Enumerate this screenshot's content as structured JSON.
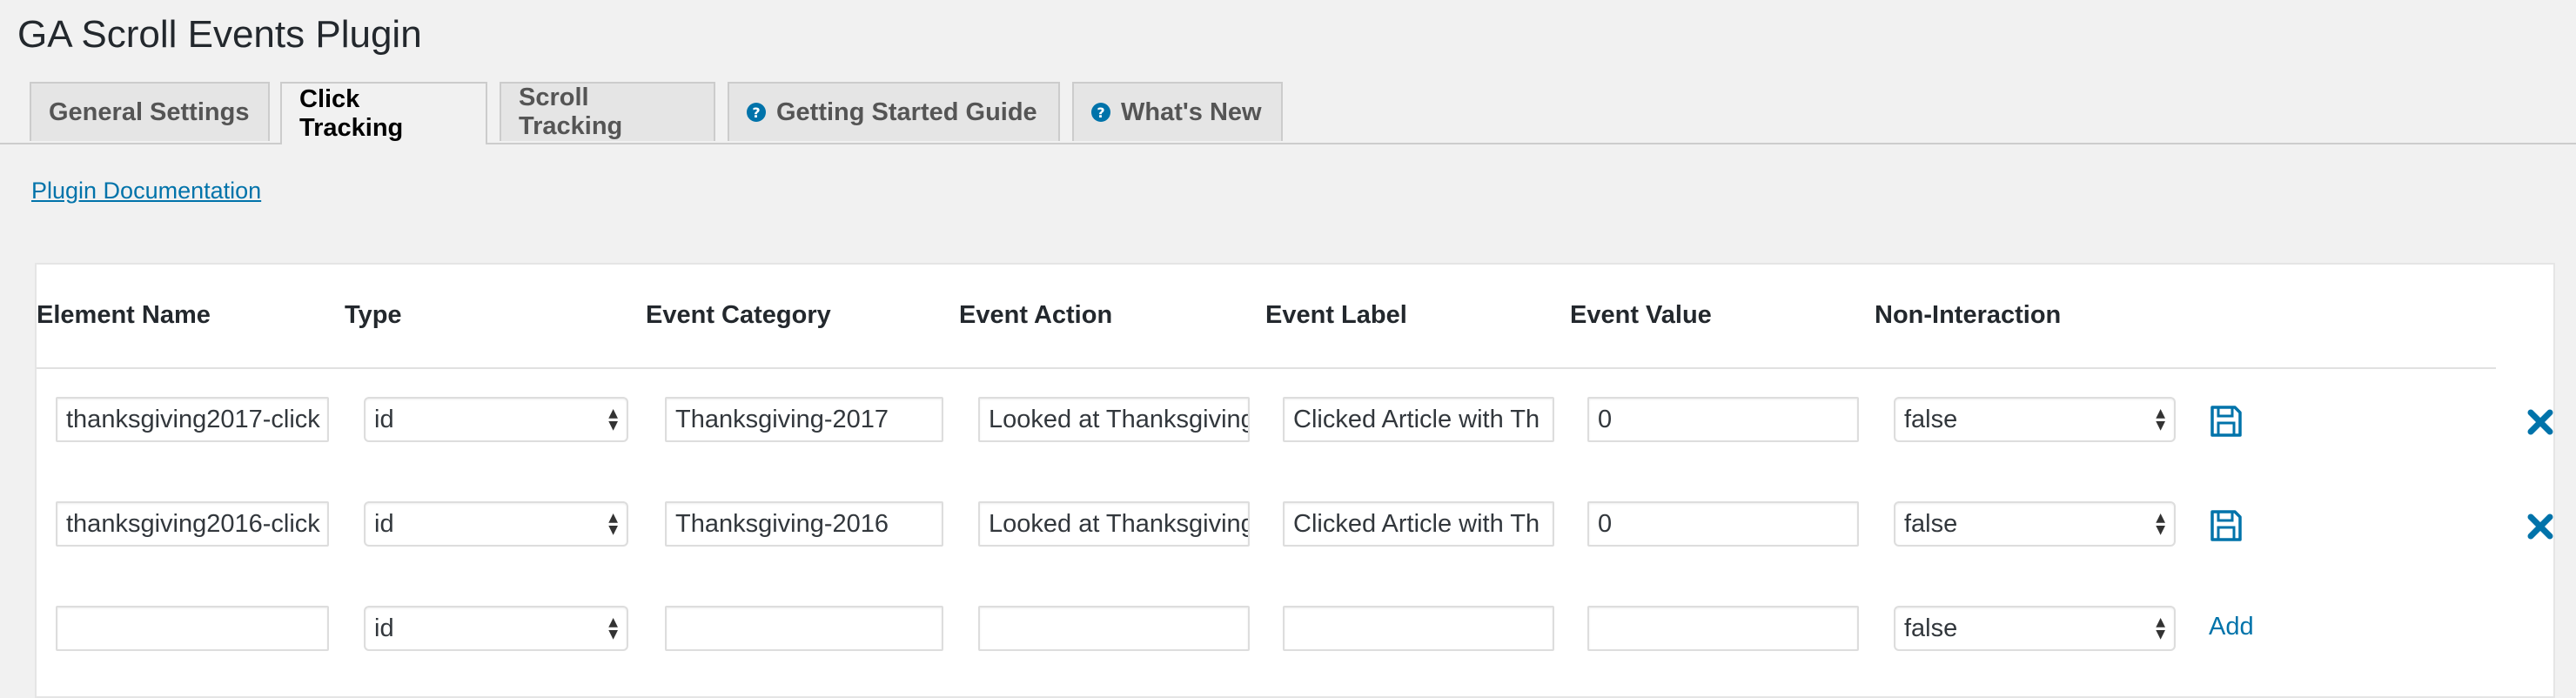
{
  "page": {
    "title": "GA Scroll Events Plugin"
  },
  "tabs": [
    {
      "label": "General Settings",
      "icon": null,
      "active": false
    },
    {
      "label": "Click Tracking",
      "icon": null,
      "active": true
    },
    {
      "label": "Scroll Tracking",
      "icon": null,
      "active": false
    },
    {
      "label": "Getting Started Guide",
      "icon": "help-icon",
      "active": false
    },
    {
      "label": "What's New",
      "icon": "help-icon",
      "active": false
    }
  ],
  "doc_link": {
    "label": "Plugin Documentation"
  },
  "table": {
    "headers": {
      "element_name": "Element Name",
      "type": "Type",
      "event_category": "Event Category",
      "event_action": "Event Action",
      "event_label": "Event Label",
      "event_value": "Event Value",
      "non_interaction": "Non-Interaction"
    },
    "rows": [
      {
        "element_name": "thanksgiving2017-click",
        "type": "id",
        "event_category": "Thanksgiving-2017",
        "event_action": "Looked at Thanksgiving",
        "event_label": "Clicked Article with Th",
        "event_value": "0",
        "non_interaction": "false",
        "save_icon": "save-icon",
        "delete_icon": "delete-x-icon"
      },
      {
        "element_name": "thanksgiving2016-click",
        "type": "id",
        "event_category": "Thanksgiving-2016",
        "event_action": "Looked at Thanksgiving",
        "event_label": "Clicked Article with Th",
        "event_value": "0",
        "non_interaction": "false",
        "save_icon": "save-icon",
        "delete_icon": "delete-x-icon"
      }
    ],
    "new_row": {
      "element_name": "",
      "type": "id",
      "event_category": "",
      "event_action": "",
      "event_label": "",
      "event_value": "",
      "non_interaction": "false",
      "add_label": "Add"
    }
  },
  "colors": {
    "accent": "#0073aa",
    "background": "#f1f1f1",
    "panel": "#ffffff"
  }
}
